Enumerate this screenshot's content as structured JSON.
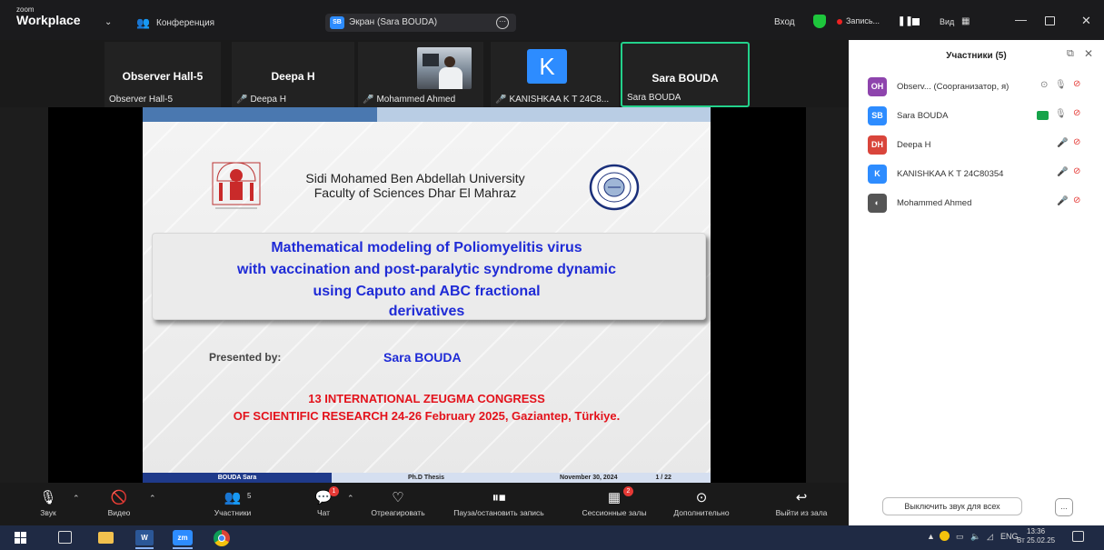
{
  "titlebar": {
    "logo_small": "zoom",
    "logo_main": "Workplace",
    "meeting_label": "Конференция",
    "screen_badge": "SB",
    "screen_label": "Экран (Sara BOUDA)",
    "enter_label": "Вход",
    "recording_label": "Запись...",
    "view_label": "Вид"
  },
  "video_strip": {
    "tiles": [
      {
        "name": "Observer Hall-5",
        "label": "Observer Hall-5"
      },
      {
        "name": "Deepa H",
        "label": "Deepa H"
      },
      {
        "name": "",
        "label": "Mohammed Ahmed"
      },
      {
        "name": "K",
        "label": "KANISHKAA K T 24C8..."
      },
      {
        "name": "Sara BOUDA",
        "label": "Sara BOUDA"
      }
    ]
  },
  "slide": {
    "university": "Sidi Mohamed Ben Abdellah University",
    "faculty": "Faculty of Sciences Dhar El Mahraz",
    "title_lines": [
      "Mathematical modeling of Poliomyelitis virus",
      "with vaccination and post-paralytic syndrome dynamic",
      "using Caputo and ABC fractional",
      "derivatives"
    ],
    "presented_by": "Presented by:",
    "presenter": "Sara BOUDA",
    "congress_line1": "13 INTERNATIONAL ZEUGMA CONGRESS",
    "congress_line2": "OF SCIENTIFIC RESEARCH 24-26 February 2025, Gaziantep, Türkiye.",
    "footer": {
      "author": "BOUDA Sara",
      "thesis": "Ph.D Thesis",
      "date": "November 30, 2024",
      "page": "1 / 22"
    }
  },
  "toolbar": {
    "audio": "Звук",
    "video": "Видео",
    "participants": "Участники",
    "participants_count": "5",
    "chat": "Чат",
    "chat_badge": "1",
    "react": "Отреагировать",
    "pause_record": "Пауза/остановить запись",
    "breakout": "Сессионные залы",
    "breakout_badge": "2",
    "more": "Дополнительно",
    "leave": "Выйти из зала"
  },
  "panel": {
    "title": "Участники (5)",
    "participants": [
      {
        "initials": "OH",
        "name": "Observ...  (Соорганизатор, я)",
        "color": "#8e44ad"
      },
      {
        "initials": "SB",
        "name": "Sara BOUDA",
        "color": "#2d8cff"
      },
      {
        "initials": "DH",
        "name": "Deepa H",
        "color": "#d9453b"
      },
      {
        "initials": "K",
        "name": "KANISHKAA K T 24C80354",
        "color": "#2d8cff"
      },
      {
        "initials": "",
        "name": "Mohammed Ahmed",
        "color": "#555555"
      }
    ],
    "mute_all": "Выключить звук для всех",
    "more": "..."
  },
  "taskbar": {
    "word_label": "W",
    "zoom_label": "zm",
    "lang": "ENG",
    "time": "13:36",
    "date": "Вт 25.02.25"
  }
}
